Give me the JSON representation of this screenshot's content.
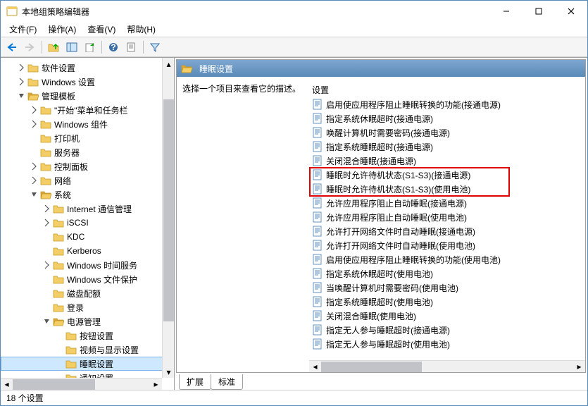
{
  "window": {
    "title": "本地组策略编辑器"
  },
  "menu": {
    "file": "文件(F)",
    "action": "操作(A)",
    "view": "查看(V)",
    "help": "帮助(H)"
  },
  "tree": [
    {
      "label": "软件设置",
      "indent": 1,
      "toggle": "closed"
    },
    {
      "label": "Windows 设置",
      "indent": 1,
      "toggle": "closed"
    },
    {
      "label": "管理模板",
      "indent": 1,
      "toggle": "open"
    },
    {
      "label": "\"开始\"菜单和任务栏",
      "indent": 2,
      "toggle": "closed"
    },
    {
      "label": "Windows 组件",
      "indent": 2,
      "toggle": "closed"
    },
    {
      "label": "打印机",
      "indent": 2,
      "toggle": "none"
    },
    {
      "label": "服务器",
      "indent": 2,
      "toggle": "none"
    },
    {
      "label": "控制面板",
      "indent": 2,
      "toggle": "closed"
    },
    {
      "label": "网络",
      "indent": 2,
      "toggle": "closed"
    },
    {
      "label": "系统",
      "indent": 2,
      "toggle": "open"
    },
    {
      "label": "Internet 通信管理",
      "indent": 3,
      "toggle": "closed"
    },
    {
      "label": "iSCSI",
      "indent": 3,
      "toggle": "closed"
    },
    {
      "label": "KDC",
      "indent": 3,
      "toggle": "none"
    },
    {
      "label": "Kerberos",
      "indent": 3,
      "toggle": "none"
    },
    {
      "label": "Windows 时间服务",
      "indent": 3,
      "toggle": "closed"
    },
    {
      "label": "Windows 文件保护",
      "indent": 3,
      "toggle": "none"
    },
    {
      "label": "磁盘配额",
      "indent": 3,
      "toggle": "none"
    },
    {
      "label": "登录",
      "indent": 3,
      "toggle": "none"
    },
    {
      "label": "电源管理",
      "indent": 3,
      "toggle": "open"
    },
    {
      "label": "按钮设置",
      "indent": 4,
      "toggle": "none"
    },
    {
      "label": "视频与显示设置",
      "indent": 4,
      "toggle": "none"
    },
    {
      "label": "睡眠设置",
      "indent": 4,
      "toggle": "none",
      "selected": true
    },
    {
      "label": "通知设置",
      "indent": 4,
      "toggle": "none"
    }
  ],
  "right": {
    "header": "睡眠设置",
    "desc": "选择一个项目来查看它的描述。",
    "col": "设置"
  },
  "items": [
    "启用使应用程序阻止睡眠转换的功能(接通电源)",
    "指定系统休眠超时(接通电源)",
    "唤醒计算机时需要密码(接通电源)",
    "指定系统睡眠超时(接通电源)",
    "关闭混合睡眠(接通电源)",
    "睡眠时允许待机状态(S1-S3)(接通电源)",
    "睡眠时允许待机状态(S1-S3)(使用电池)",
    "允许应用程序阻止自动睡眠(接通电源)",
    "允许应用程序阻止自动睡眠(使用电池)",
    "允许打开网络文件时自动睡眠(接通电源)",
    "允许打开网络文件时自动睡眠(使用电池)",
    "启用使应用程序阻止睡眠转换的功能(使用电池)",
    "指定系统休眠超时(使用电池)",
    "当唤醒计算机时需要密码(使用电池)",
    "指定系统睡眠超时(使用电池)",
    "关闭混合睡眠(使用电池)",
    "指定无人参与睡眠超时(接通电源)",
    "指定无人参与睡眠超时(使用电池)"
  ],
  "highlight": {
    "start": 5,
    "count": 2
  },
  "tabs": {
    "extended": "扩展",
    "standard": "标准"
  },
  "status": "18 个设置"
}
